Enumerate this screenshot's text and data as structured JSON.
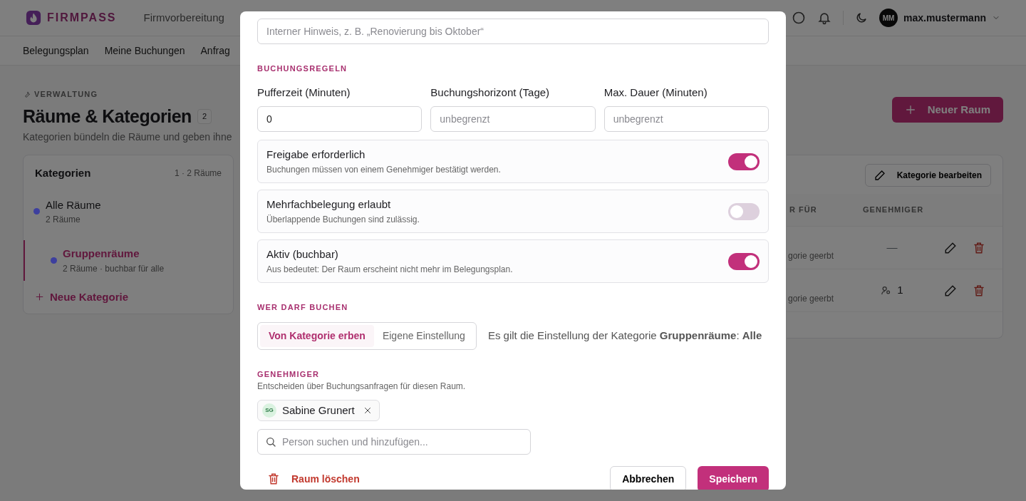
{
  "app": {
    "brand": "FIRMPASS"
  },
  "top_nav": [
    {
      "label": "Firmvorbereitung",
      "selected": false
    }
  ],
  "user": {
    "initials": "MM",
    "name": "max.mustermann"
  },
  "sub_nav": [
    {
      "label": "Belegungsplan"
    },
    {
      "label": "Meine Buchungen"
    },
    {
      "label": "Anfrag"
    }
  ],
  "page": {
    "eyebrow": "VERWALTUNG",
    "title": "Räume & Kategorien",
    "count": "2",
    "subtitle": "Kategorien bündeln die Räume und geben ihne",
    "primary_button": "Neuer Raum"
  },
  "categories": {
    "title": "Kategorien",
    "summary": "1 · 2 Räume",
    "tree": [
      {
        "name": "Alle Räume",
        "meta": "2 Räume",
        "color": "#3d3f9e",
        "selected": false,
        "children": [
          {
            "name": "Gruppenräume",
            "meta": "2 Räume · buchbar für alle",
            "color": "#3d3f9e",
            "selected": true
          }
        ]
      }
    ],
    "add_label": "Neue Kategorie"
  },
  "room_table": {
    "edit_button": "Kategorie bearbeiten",
    "columns": [
      "R FÜR",
      "GENEHMIGER"
    ],
    "rows": [
      {
        "column_1": "gorie geerbt",
        "kind": "none",
        "approvers": "—"
      },
      {
        "column_1": "gorie geerbt",
        "kind": "count",
        "approvers": "1"
      }
    ]
  },
  "modal": {
    "note_field": {
      "placeholder": "Interner Hinweis, z. B. „Renovierung bis Oktober“"
    },
    "rules": {
      "heading": "BUCHUNGSREGELN",
      "fields": [
        {
          "label": "Pufferzeit (Minuten)",
          "value": "0"
        },
        {
          "label": "Buchungshorizont (Tage)",
          "placeholder": "unbegrenzt"
        },
        {
          "label": "Max. Dauer (Minuten)",
          "placeholder": "unbegrenzt"
        }
      ],
      "toggles": [
        {
          "label": "Freigabe erforderlich",
          "description": "Buchungen müssen von einem Genehmiger bestätigt werden.",
          "on": true
        },
        {
          "label": "Mehrfachbelegung erlaubt",
          "description": "Überlappende Buchungen sind zulässig.",
          "on": false
        },
        {
          "label": "Aktiv (buchbar)",
          "description": "Aus bedeutet: Der Raum erscheint nicht mehr im Belegungsplan.",
          "on": true
        }
      ]
    },
    "access": {
      "heading": "WER DARF BUCHEN",
      "options": [
        {
          "label": "Von Kategorie erben",
          "selected": true
        },
        {
          "label": "Eigene Einstellung",
          "selected": false
        }
      ],
      "note": "Es gilt die Einstellung der Kategorie **Gruppenräume**: **Alle**"
    },
    "approvers": {
      "heading": "GENEHMIGER",
      "description": "Entscheiden über Buchungsanfragen für diesen Raum.",
      "people": [
        {
          "initials": "SG",
          "name": "Sabine Grunert"
        }
      ],
      "search_placeholder": "Person suchen und hinzufügen..."
    },
    "footer": {
      "delete": "Raum löschen",
      "cancel": "Abbrechen",
      "save": "Speichern"
    }
  }
}
